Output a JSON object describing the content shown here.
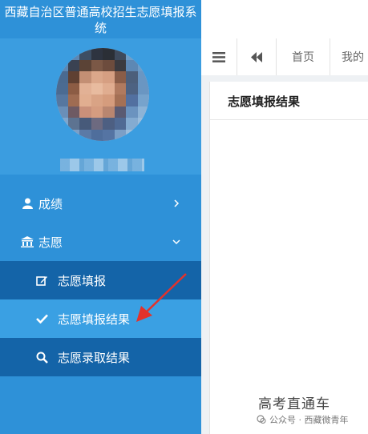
{
  "app": {
    "title": "西藏自治区普通高校招生志愿填报系统"
  },
  "sidebar": {
    "menu": [
      {
        "label": "成绩",
        "icon": "user-icon"
      },
      {
        "label": "志愿",
        "icon": "bank-icon"
      }
    ],
    "submenu": [
      {
        "label": "志愿填报",
        "icon": "edit-icon"
      },
      {
        "label": "志愿填报结果",
        "icon": "check-icon"
      },
      {
        "label": "志愿录取结果",
        "icon": "search-icon"
      }
    ]
  },
  "topbar": {
    "tabs": [
      "首页",
      "我的"
    ]
  },
  "panel": {
    "title": "志愿填报结果"
  },
  "watermark": {
    "main": "高考直通车",
    "sub": "公众号 · 西藏微青年"
  },
  "colors": {
    "sidebar": "#2e91d8",
    "submenu_dark": "#1464a8",
    "submenu_active": "#3aa0e3",
    "arrow": "#e3322b"
  }
}
